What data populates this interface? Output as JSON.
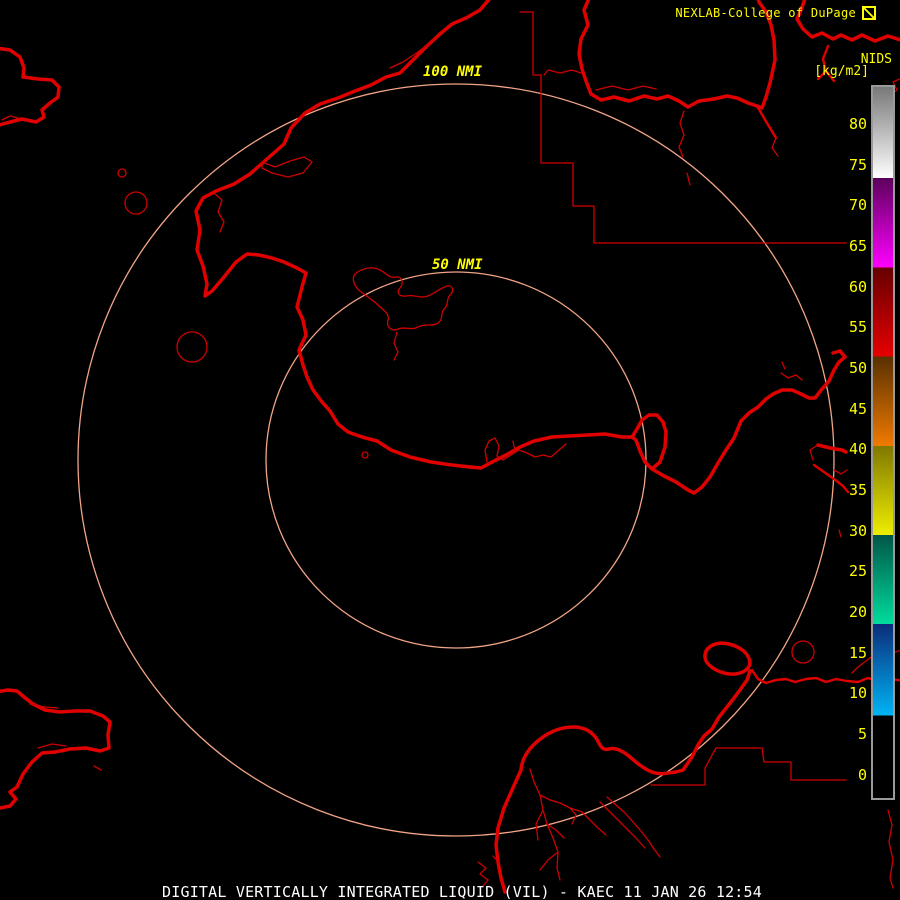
{
  "header": {
    "branding": "NEXLAB-College of DuPage",
    "glyph_icon": "square-falling-diagonal"
  },
  "legend": {
    "title": "NIDS",
    "units": "[kg/m2]",
    "ticks": [
      "80",
      "75",
      "70",
      "65",
      "60",
      "55",
      "50",
      "45",
      "40",
      "35",
      "30",
      "25",
      "20",
      "15",
      "10",
      "5",
      "0"
    ],
    "scale_segments": [
      {
        "values": "73-84",
        "top_color": "#787878",
        "bottom_color": "#ffffff"
      },
      {
        "values": "62-73",
        "top_color": "#5c005c",
        "bottom_color": "#ff00ff"
      },
      {
        "values": "51-62",
        "top_color": "#660000",
        "bottom_color": "#e60000"
      },
      {
        "values": "40-51",
        "top_color": "#583000",
        "bottom_color": "#f07a00"
      },
      {
        "values": "29-40",
        "top_color": "#807800",
        "bottom_color": "#eeee00"
      },
      {
        "values": "18-29",
        "top_color": "#005648",
        "bottom_color": "#00dc9c"
      },
      {
        "values": "7-18",
        "top_color": "#0c2c7a",
        "bottom_color": "#00b4f4"
      },
      {
        "values": "0-7",
        "top_color": "#000000",
        "bottom_color": "#000000"
      }
    ]
  },
  "map": {
    "outer_ring_label": "100 NMI",
    "inner_ring_label": "50 NMI"
  },
  "footer": {
    "product_line": "DIGITAL VERTICALLY INTEGRATED LIQUID (VIL) - KAEC 11 JAN 26 12:54"
  },
  "colors": {
    "background": "#000000",
    "map_outline": "#e00000",
    "range_ring": "#f2a586",
    "label_yellow": "#ffff00",
    "title_white": "#ffffff",
    "colorbar_border": "#9a9a9a"
  }
}
